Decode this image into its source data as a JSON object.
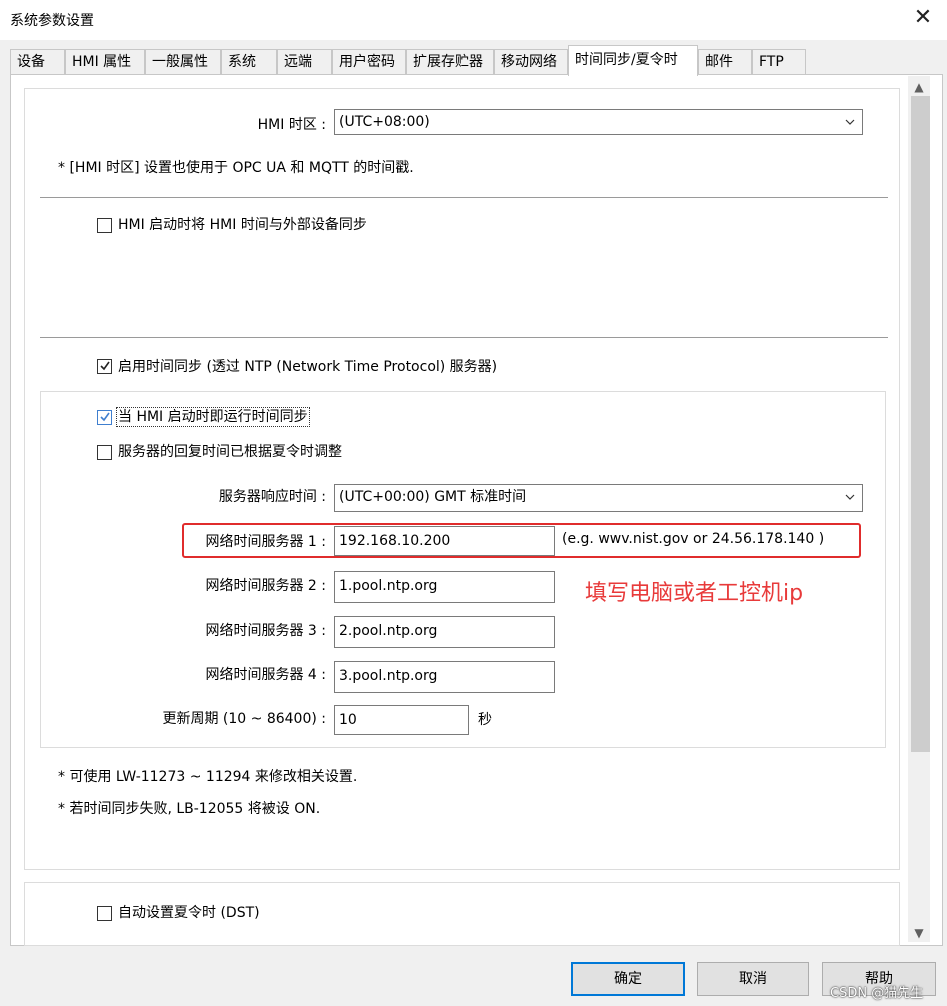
{
  "window": {
    "title": "系统参数设置",
    "close_glyph": "✕"
  },
  "tabs": [
    {
      "label": "设备",
      "active": false
    },
    {
      "label": "HMI 属性",
      "active": false
    },
    {
      "label": "一般属性",
      "active": false
    },
    {
      "label": "系统",
      "active": false
    },
    {
      "label": "远端",
      "active": false
    },
    {
      "label": "用户密码",
      "active": false
    },
    {
      "label": "扩展存贮器",
      "active": false
    },
    {
      "label": "移动网络",
      "active": false
    },
    {
      "label": "时间同步/夏令时",
      "active": true
    },
    {
      "label": "邮件",
      "active": false
    },
    {
      "label": "FTP",
      "active": false
    }
  ],
  "timezone": {
    "label": "HMI 时区 :",
    "value": "(UTC+08:00)",
    "note": "* [HMI 时区] 设置也使用于 OPC UA 和 MQTT 的时间戳."
  },
  "sync_external": {
    "label": "HMI 启动时将 HMI 时间与外部设备同步",
    "checked": false
  },
  "ntp": {
    "enable_label": "启用时间同步 (透过 NTP (Network Time Protocol) 服务器)",
    "enable_checked": true,
    "run_on_startup_label": "当 HMI 启动时即运行时间同步",
    "run_on_startup_checked": true,
    "dst_adjusted_label": "服务器的回复时间已根据夏令时调整",
    "dst_adjusted_checked": false,
    "response_time_label": "服务器响应时间 :",
    "response_time_value": "(UTC+00:00) GMT 标准时间",
    "servers": [
      {
        "label": "网络时间服务器 1 :",
        "value": "192.168.10.200"
      },
      {
        "label": "网络时间服务器 2 :",
        "value": "1.pool.ntp.org"
      },
      {
        "label": "网络时间服务器 3 :",
        "value": "2.pool.ntp.org"
      },
      {
        "label": "网络时间服务器 4 :",
        "value": "3.pool.ntp.org"
      }
    ],
    "server_example": "(e.g. wwv.nist.gov or 24.56.178.140 )",
    "update_period_label": "更新周期 (10 ~ 86400) :",
    "update_period_value": "10",
    "update_period_unit": "秒"
  },
  "annotation": "填写电脑或者工控机ip",
  "notes": [
    "* 可使用 LW-11273 ~ 11294 来修改相关设置.",
    "* 若时间同步失败, LB-12055 将被设 ON."
  ],
  "dst": {
    "label": "自动设置夏令时 (DST)",
    "checked": false
  },
  "buttons": {
    "ok": "确定",
    "cancel": "取消",
    "help": "帮助"
  },
  "watermark": "CSDN @猫先生",
  "colors": {
    "annotation_red": "#e02c2c",
    "accent_blue": "#0078d7"
  }
}
